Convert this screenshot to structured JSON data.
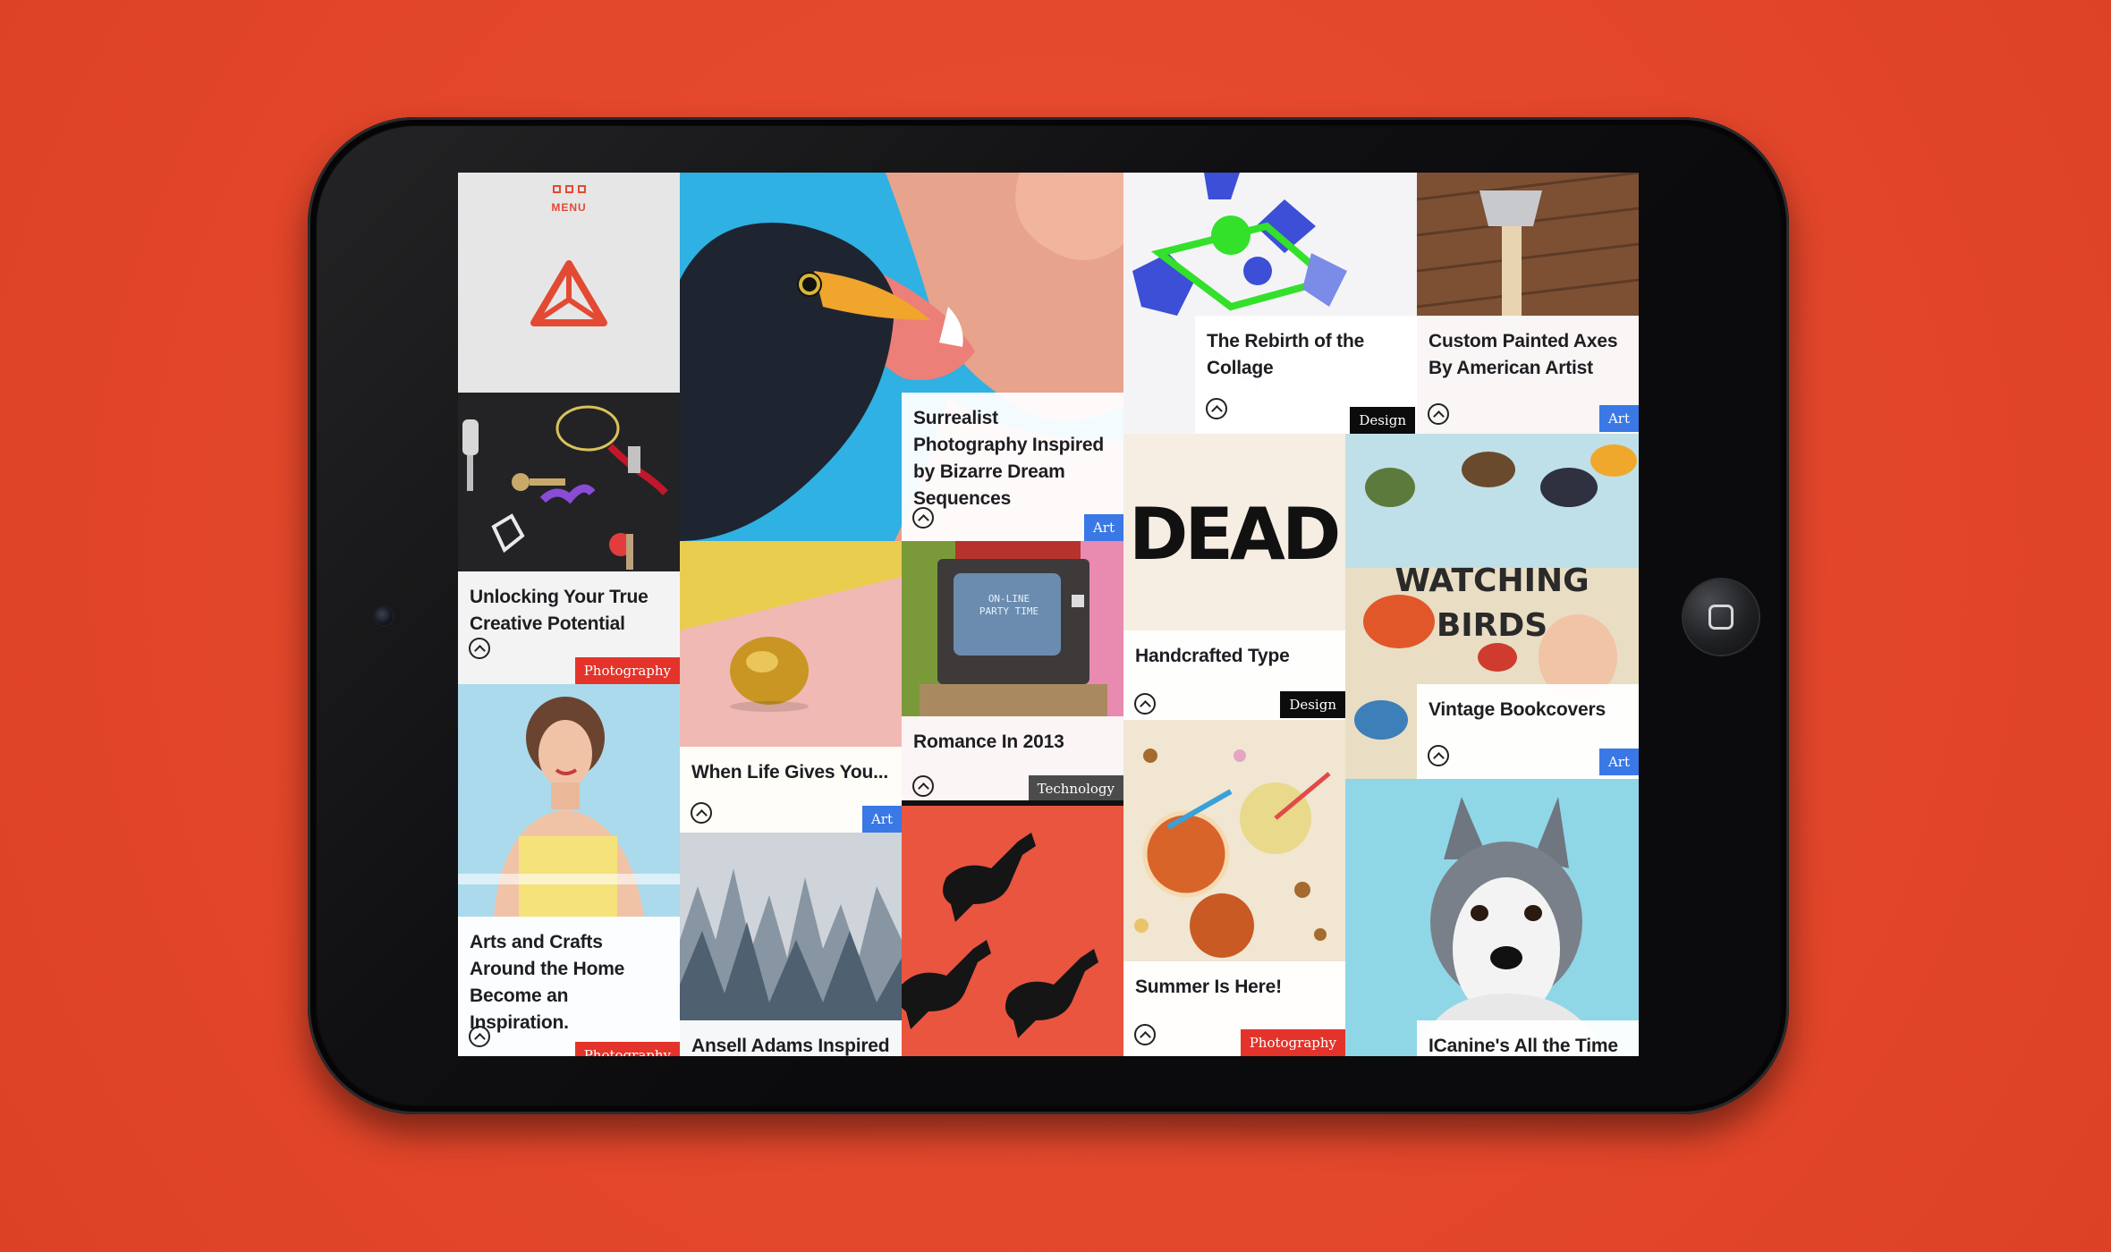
{
  "menu": {
    "label": "MENU"
  },
  "colors": {
    "background": "#e5492f",
    "accent": "#e34a33",
    "tag_art": "#3a78e6",
    "tag_photography": "#e4332a",
    "tag_design": "#0c0c0c",
    "tag_technology": "#4b4b4b"
  },
  "icons": {
    "menu": "menu-grid-icon",
    "logo": "triangle-logo-icon",
    "upvote": "chevron-up-circle-icon"
  },
  "articles": [
    {
      "title": "Unlocking Your True Creative Potential",
      "tag": "Photography"
    },
    {
      "title": "Arts and Crafts Around the Home Become an Inspiration.",
      "tag": "Photography"
    },
    {
      "title": "Surrealist Photography Inspired by Bizarre Dream Sequences",
      "tag": "Art"
    },
    {
      "title": "When Life Gives You...",
      "tag": "Art"
    },
    {
      "title": "Ansell Adams Inspired",
      "tag": ""
    },
    {
      "title": "Romance In 2013",
      "tag": "Technology"
    },
    {
      "title": "The Rebirth of the Collage",
      "tag": "Design"
    },
    {
      "title": "Handcrafted Type",
      "tag": "Design"
    },
    {
      "title": "Summer Is Here!",
      "tag": "Photography"
    },
    {
      "title": "Custom Painted Axes By American Artist",
      "tag": "Art"
    },
    {
      "title": "Vintage Bookcovers",
      "tag": "Art"
    },
    {
      "title": "ICanine's All the Time",
      "tag": ""
    }
  ],
  "image_text": {
    "dead": "DEAD",
    "watching_birds_1": "WATCHING",
    "watching_birds_2": "BIRDS",
    "tv_screen_1": "ON-LINE",
    "tv_screen_2": "PARTY TIME"
  }
}
